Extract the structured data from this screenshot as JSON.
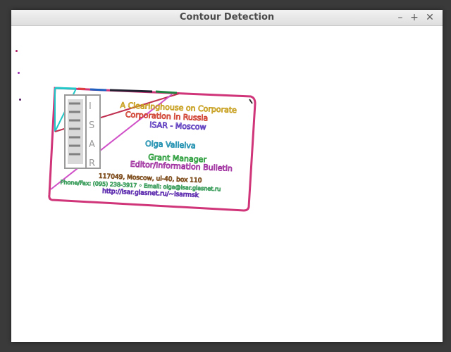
{
  "window": {
    "title": "Contour Detection",
    "controls": {
      "minimize": "–",
      "maximize": "+",
      "close": "✕"
    }
  },
  "card": {
    "side_text": [
      "I",
      "S",
      "A",
      "R"
    ],
    "org_lines": [
      "A Clearinghouse on Corporate",
      "Corporation in Russia",
      "ISAR - Moscow"
    ],
    "person_name": "Olga Valieiva",
    "person_title": [
      "Grant Manager",
      "Editor/Information Bulletin"
    ],
    "contact_lines": [
      "117049, Moscow, ul-40, box 110",
      "Phone/Fax: (095) 238-3917 • Email: olga@isar.glasnet.ru",
      "http://isar.glasnet.ru/~isarmsk"
    ]
  },
  "colors": {
    "card_outline": "#d0357a",
    "diagonal_a": "#c03050",
    "diagonal_b": "#d050c8",
    "corner_cyan": "#20c8c8",
    "logo_gray": "#9a9a9a"
  }
}
